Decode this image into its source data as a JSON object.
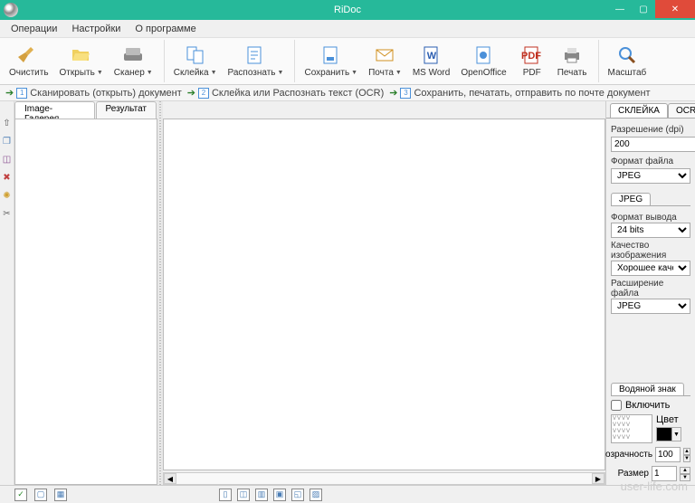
{
  "window": {
    "title": "RiDoc"
  },
  "menu": {
    "operations": "Операции",
    "settings": "Настройки",
    "about": "О программе"
  },
  "toolbar": {
    "clean": "Очистить",
    "open": "Открыть",
    "scanner": "Сканер",
    "stitch": "Склейка",
    "recognize": "Распознать",
    "save": "Сохранить",
    "mail": "Почта",
    "msword": "MS Word",
    "openoffice": "OpenOffice",
    "pdf": "PDF",
    "print": "Печать",
    "zoom": "Масштаб"
  },
  "hints": {
    "h1": "Сканировать (открыть) документ",
    "h2": "Склейка или Распознать текст (OCR)",
    "h3": "Сохранить, печатать, отправить по почте документ"
  },
  "tabs": {
    "gallery": "Image-Галерея",
    "result": "Результат"
  },
  "right": {
    "tab_stitch": "СКЛЕЙКА",
    "tab_ocr": "OCR",
    "resolution_label": "Разрешение (dpi)",
    "resolution_value": "200",
    "fileformat_label": "Формат файла",
    "fileformat_value": "JPEG",
    "jpeg_tab": "JPEG",
    "output_format_label": "Формат вывода",
    "output_format_value": "24 bits",
    "quality_label": "Качество изображения",
    "quality_value": "Хорошее качество",
    "ext_label": "Расширение файла",
    "ext_value": "JPEG",
    "watermark_tab": "Водяной знак",
    "include_label": "Включить",
    "color_label": "Цвет",
    "transparency_label": "Прозрачность",
    "transparency_value": "100",
    "size_label": "Размер",
    "size_value": "1"
  },
  "watermark_overlay": "user-life.com"
}
